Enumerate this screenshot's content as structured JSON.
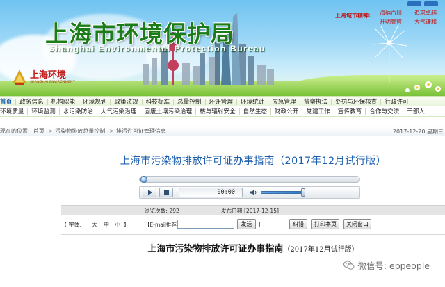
{
  "header": {
    "site_title_cn": "上海市环境保护局",
    "site_title_en": "Shanghai Environmental Protection Bureau",
    "logo_cn": "上海环境",
    "logo_en": "SHANGHAI ENVIRONMENT",
    "spirit_label": "上海城市精神:",
    "spirit_items": [
      "海纳百川",
      "追求卓越",
      "开明睿智",
      "大气谦和"
    ]
  },
  "nav_primary": [
    "首页",
    "政务信息",
    "机构职能",
    "环境规划",
    "政策法规",
    "科技标准",
    "总量控制",
    "环评管理",
    "环境统计",
    "应急管理",
    "监察执法",
    "处罚与环保核查",
    "行政许可"
  ],
  "nav_secondary": [
    "环境质量",
    "环境监测",
    "水污染防治",
    "大气污染治理",
    "固废土壤污染治理",
    "核与辐射安全",
    "自然生态",
    "财政公开",
    "党建工作",
    "宣传教育",
    "合作与交流",
    "干部人"
  ],
  "breadcrumb": {
    "prefix": "现在的位置:",
    "items": [
      "首页",
      "污染物排放总量控制",
      "排污许可证管理信息"
    ],
    "date": "2017-12-20  星期三"
  },
  "article": {
    "title": "上海市污染物排放许可证办事指南（2017年12月试行版）",
    "player": {
      "time": "00:00",
      "progress": 0,
      "volume": 1
    },
    "views_label": "浏览次数:",
    "views": "292",
    "pubdate_label": "发布日期:",
    "pubdate": "[2017-12-15]",
    "font_label": "【 字体:",
    "font_options": [
      "大",
      "中",
      "小"
    ],
    "font_close": "】",
    "email_label": "【E-mail推荐",
    "email_value": "",
    "send_label": "发送",
    "email_close": "】",
    "error_label": "纠错",
    "print_label": "打印本页",
    "close_label": "关闭窗口",
    "doc_title_main": "上海市污染物排放许可证办事指南",
    "doc_title_sub": "（2017年12月试行版）"
  },
  "watermark": {
    "text": "微信号: eppeople"
  }
}
